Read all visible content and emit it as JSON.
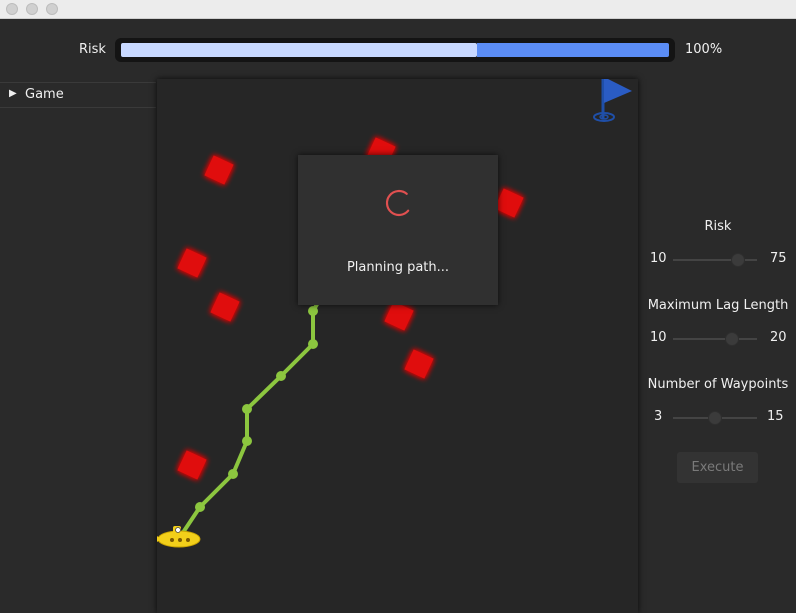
{
  "risk_bar": {
    "label": "Risk",
    "percent_text": "100%",
    "value": 1.0,
    "light_fraction": 0.65,
    "accent": "#5b8df5",
    "light": "#c8d8ff"
  },
  "sidebar": {
    "items": [
      {
        "label": "Game",
        "expander_icon": "triangle-right-icon"
      }
    ]
  },
  "game": {
    "obstacle_color": "#e01010",
    "path_color": "#8cc63f",
    "goal_flag_color": "#1f4fa8",
    "vehicle": "yellow-submarine-icon",
    "goal": "flag-icon"
  },
  "modal": {
    "message": "Planning path...",
    "spinner_color": "#e05050"
  },
  "controls": {
    "sliders": [
      {
        "title": "Risk",
        "min": "10",
        "max": "75",
        "value": 60
      },
      {
        "title": "Maximum Lag Length",
        "min": "10",
        "max": "20",
        "value": 17
      },
      {
        "title": "Number of Waypoints",
        "min": "3",
        "max": "15",
        "value": 9
      }
    ],
    "execute_label": "Execute"
  }
}
